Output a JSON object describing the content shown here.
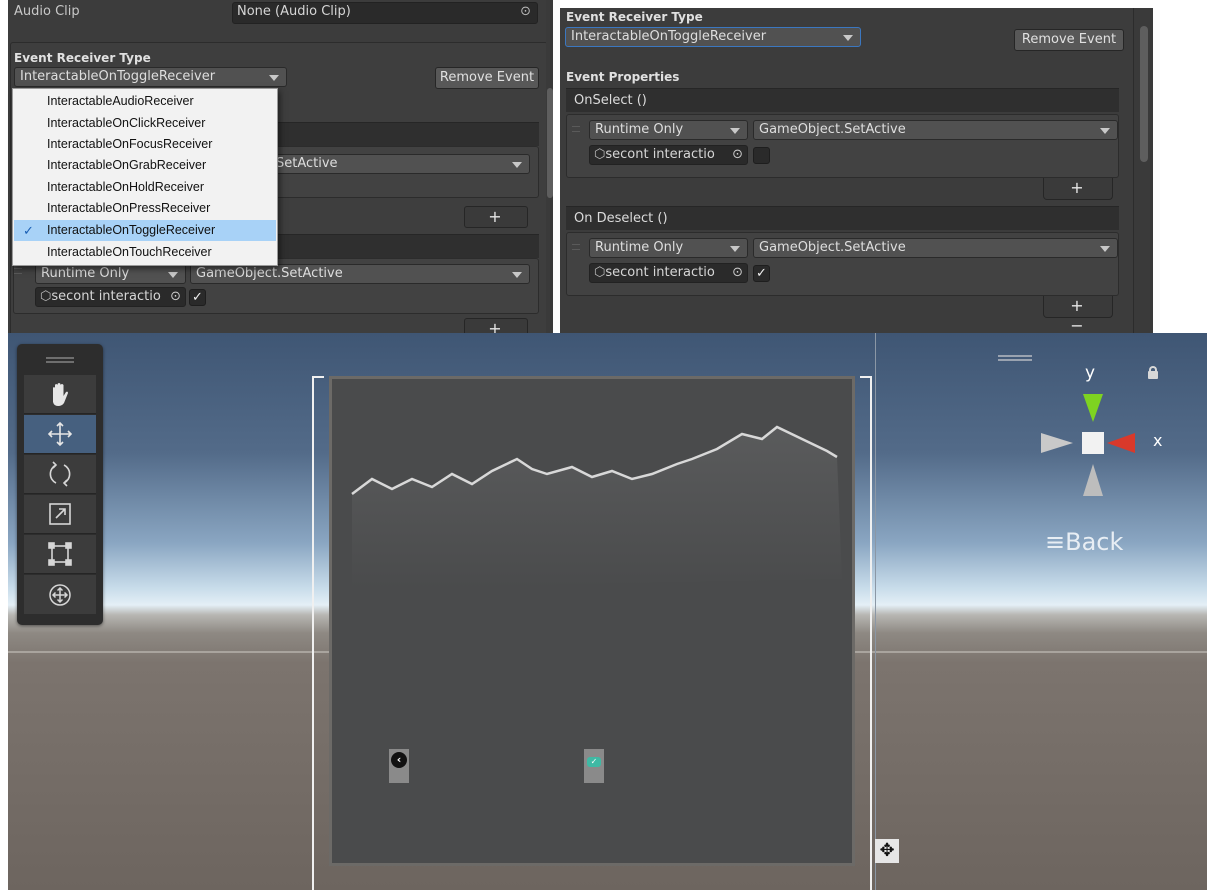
{
  "left_inspector": {
    "audio_clip_label": "Audio Clip",
    "audio_clip_value": "None (Audio Clip)",
    "event_receiver_type_label": "Event Receiver Type",
    "event_receiver_type_value": "InteractableOnToggleReceiver",
    "remove_event_label": "Remove Event",
    "dropdown_options": [
      {
        "label": "InteractableAudioReceiver",
        "selected": false
      },
      {
        "label": "InteractableOnClickReceiver",
        "selected": false
      },
      {
        "label": "InteractableOnFocusReceiver",
        "selected": false
      },
      {
        "label": "InteractableOnGrabReceiver",
        "selected": false
      },
      {
        "label": "InteractableOnHoldReceiver",
        "selected": false
      },
      {
        "label": "InteractableOnPressReceiver",
        "selected": false
      },
      {
        "label": "InteractableOnToggleReceiver",
        "selected": true
      },
      {
        "label": "InteractableOnTouchReceiver",
        "selected": false
      }
    ],
    "partial_function_value": "SetActive",
    "runtime_value": "Runtime Only",
    "function_value": "GameObject.SetActive",
    "object_value": "secont interactio",
    "checkbox_checked": true,
    "add_remove": "+ −"
  },
  "right_inspector": {
    "event_receiver_type_label": "Event Receiver Type",
    "event_receiver_type_value": "InteractableOnToggleReceiver",
    "remove_event_label": "Remove Event",
    "event_properties_label": "Event Properties",
    "events": [
      {
        "header": "OnSelect ()",
        "runtime_value": "Runtime Only",
        "function_value": "GameObject.SetActive",
        "object_value": "secont interactio",
        "checked": false
      },
      {
        "header": "On Deselect ()",
        "runtime_value": "Runtime Only",
        "function_value": "GameObject.SetActive",
        "object_value": "secont interactio",
        "checked": true
      }
    ],
    "add_remove": "+ −"
  },
  "scene_view": {
    "tools": [
      "hand-tool",
      "move-tool",
      "rotate-tool",
      "scale-tool",
      "rect-tool",
      "transform-tool"
    ],
    "active_tool": "move-tool",
    "gizmo_y_label": "y",
    "gizmo_x_label": "x",
    "back_label": "Back",
    "colors": {
      "y_axis": "#7ed321",
      "x_axis": "#d9392b",
      "sky": "#536b89",
      "ground": "#6d655f"
    }
  }
}
